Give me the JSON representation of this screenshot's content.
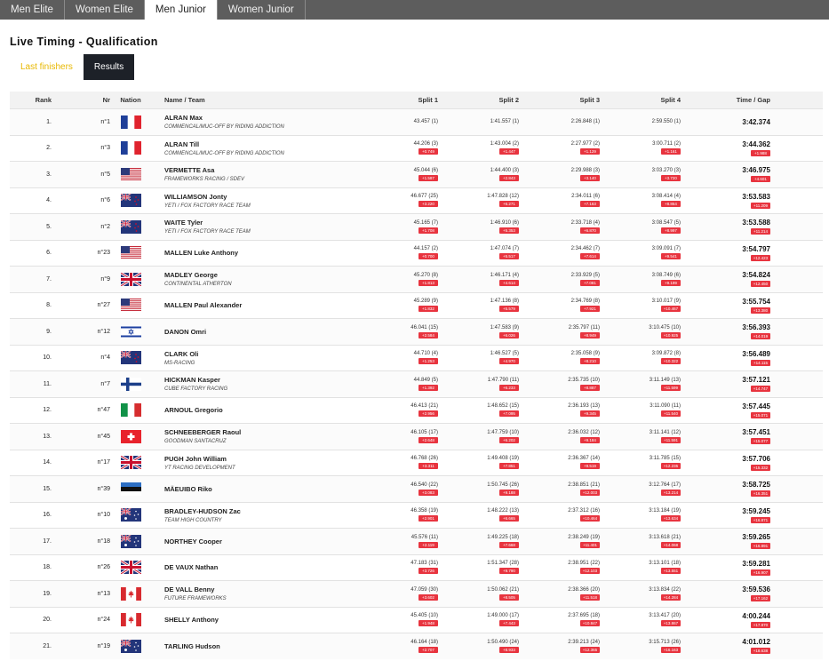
{
  "tabs": [
    {
      "label": "Men Elite",
      "active": false
    },
    {
      "label": "Women Elite",
      "active": false
    },
    {
      "label": "Men Junior",
      "active": true
    },
    {
      "label": "Women Junior",
      "active": false
    }
  ],
  "page_title": "Live Timing - Qualification",
  "subtabs": {
    "last_finishers": "Last finishers",
    "results": "Results"
  },
  "columns": {
    "rank": "Rank",
    "nr": "Nr",
    "nation": "Nation",
    "name": "Name / Team",
    "split1": "Split 1",
    "split2": "Split 2",
    "split3": "Split 3",
    "split4": "Split 4",
    "time": "Time / Gap"
  },
  "colors": {
    "gap_badge": "#e8343f",
    "tabs_bg": "#5d5d5d",
    "results_btn": "#1d2128",
    "last_finishers": "#e8b800"
  },
  "rows": [
    {
      "rank": "1.",
      "nr": "n°1",
      "flag": "fr",
      "name": "ALRAN Max",
      "team": "COMMENCAL/MUC-OFF BY RIDING ADDICTION",
      "s1": "43.457 (1)",
      "g1": "",
      "s2": "1:41.557 (1)",
      "g2": "",
      "s3": "2:26.848 (1)",
      "g3": "",
      "s4": "2:59.550 (1)",
      "g4": "",
      "time": "3:42.374",
      "gap": ""
    },
    {
      "rank": "2.",
      "nr": "n°3",
      "flag": "fr",
      "name": "ALRAN Till",
      "team": "COMMENCAL/MUC-OFF BY RIDING ADDICTION",
      "s1": "44.206 (3)",
      "g1": "+0.749",
      "s2": "1:43.004 (2)",
      "g2": "+1.447",
      "s3": "2:27.977 (2)",
      "g3": "+1.129",
      "s4": "3:00.711 (2)",
      "g4": "+1.161",
      "time": "3:44.362",
      "gap": "+1.988"
    },
    {
      "rank": "3.",
      "nr": "n°5",
      "flag": "us",
      "name": "VERMETTE Asa",
      "team": "FRAMEWORKS RACING / SDEV",
      "s1": "45.044 (6)",
      "g1": "+1.587",
      "s2": "1:44.400 (3)",
      "g2": "+2.843",
      "s3": "2:29.988 (3)",
      "g3": "+3.140",
      "s4": "3:03.270 (3)",
      "g4": "+3.720",
      "time": "3:46.975",
      "gap": "+4.601"
    },
    {
      "rank": "4.",
      "nr": "n°6",
      "flag": "nz",
      "name": "WILLIAMSON Jonty",
      "team": "YETI / FOX FACTORY RACE TEAM",
      "s1": "46.677 (25)",
      "g1": "+3.220",
      "s2": "1:47.828 (12)",
      "g2": "+6.271",
      "s3": "2:34.011 (6)",
      "g3": "+7.163",
      "s4": "3:08.414 (4)",
      "g4": "+8.864",
      "time": "3:53.583",
      "gap": "+11.209"
    },
    {
      "rank": "5.",
      "nr": "n°2",
      "flag": "nz",
      "name": "WAITE Tyler",
      "team": "YETI / FOX FACTORY RACE TEAM",
      "s1": "45.165 (7)",
      "g1": "+1.708",
      "s2": "1:46.910 (6)",
      "g2": "+5.353",
      "s3": "2:33.718 (4)",
      "g3": "+6.870",
      "s4": "3:08.547 (5)",
      "g4": "+8.997",
      "time": "3:53.588",
      "gap": "+11.214"
    },
    {
      "rank": "6.",
      "nr": "n°23",
      "flag": "us",
      "name": "MALLEN Luke Anthony",
      "team": "",
      "s1": "44.157 (2)",
      "g1": "+0.700",
      "s2": "1:47.074 (7)",
      "g2": "+5.517",
      "s3": "2:34.462 (7)",
      "g3": "+7.614",
      "s4": "3:09.091 (7)",
      "g4": "+9.541",
      "time": "3:54.797",
      "gap": "+12.423"
    },
    {
      "rank": "7.",
      "nr": "n°9",
      "flag": "gb",
      "name": "MADLEY George",
      "team": "CONTINENTAL ATHERTON",
      "s1": "45.270 (8)",
      "g1": "+1.813",
      "s2": "1:46.171 (4)",
      "g2": "+4.614",
      "s3": "2:33.929 (5)",
      "g3": "+7.081",
      "s4": "3:08.749 (6)",
      "g4": "+9.199",
      "time": "3:54.824",
      "gap": "+12.450"
    },
    {
      "rank": "8.",
      "nr": "n°27",
      "flag": "us",
      "name": "MALLEN Paul Alexander",
      "team": "",
      "s1": "45.289 (9)",
      "g1": "+1.832",
      "s2": "1:47.136 (8)",
      "g2": "+5.579",
      "s3": "2:34.769 (8)",
      "g3": "+7.921",
      "s4": "3:10.017 (9)",
      "g4": "+10.467",
      "time": "3:55.754",
      "gap": "+13.380"
    },
    {
      "rank": "9.",
      "nr": "n°12",
      "flag": "il",
      "name": "DANON Omri",
      "team": "",
      "s1": "46.041 (15)",
      "g1": "+2.584",
      "s2": "1:47.583 (9)",
      "g2": "+6.026",
      "s3": "2:35.797 (11)",
      "g3": "+8.949",
      "s4": "3:10.475 (10)",
      "g4": "+10.925",
      "time": "3:56.393",
      "gap": "+14.019"
    },
    {
      "rank": "10.",
      "nr": "n°4",
      "flag": "nz",
      "name": "CLARK Oli",
      "team": "MS-RACING",
      "s1": "44.710 (4)",
      "g1": "+1.253",
      "s2": "1:46.527 (5)",
      "g2": "+4.970",
      "s3": "2:35.058 (9)",
      "g3": "+8.210",
      "s4": "3:09.872 (8)",
      "g4": "+10.322",
      "time": "3:56.489",
      "gap": "+14.115"
    },
    {
      "rank": "11.",
      "nr": "n°7",
      "flag": "fi",
      "name": "HICKMAN Kasper",
      "team": "CUBE FACTORY RACING",
      "s1": "44.849 (5)",
      "g1": "+1.392",
      "s2": "1:47.790 (11)",
      "g2": "+6.233",
      "s3": "2:35.735 (10)",
      "g3": "+8.887",
      "s4": "3:11.149 (13)",
      "g4": "+11.599",
      "time": "3:57.121",
      "gap": "+14.747"
    },
    {
      "rank": "12.",
      "nr": "n°47",
      "flag": "it",
      "name": "ARNOUL Gregorio",
      "team": "",
      "s1": "46.413 (21)",
      "g1": "+2.956",
      "s2": "1:48.652 (15)",
      "g2": "+7.095",
      "s3": "2:36.193 (13)",
      "g3": "+9.345",
      "s4": "3:11.090 (11)",
      "g4": "+11.540",
      "time": "3:57.445",
      "gap": "+15.071"
    },
    {
      "rank": "13.",
      "nr": "n°45",
      "flag": "ch",
      "name": "SCHNEEBERGER Raoul",
      "team": "GOODMAN SANTACRUZ",
      "s1": "46.105 (17)",
      "g1": "+2.648",
      "s2": "1:47.759 (10)",
      "g2": "+6.202",
      "s3": "2:36.032 (12)",
      "g3": "+9.184",
      "s4": "3:11.141 (12)",
      "g4": "+11.591",
      "time": "3:57.451",
      "gap": "+15.077"
    },
    {
      "rank": "14.",
      "nr": "n°17",
      "flag": "gb",
      "name": "PUGH John William",
      "team": "YT RACING DEVELOPMENT",
      "s1": "46.768 (26)",
      "g1": "+3.311",
      "s2": "1:49.408 (19)",
      "g2": "+7.851",
      "s3": "2:36.367 (14)",
      "g3": "+9.519",
      "s4": "3:11.785 (15)",
      "g4": "+12.235",
      "time": "3:57.706",
      "gap": "+15.332"
    },
    {
      "rank": "15.",
      "nr": "n°39",
      "flag": "ee",
      "name": "MÄEUIBO Riko",
      "team": "",
      "s1": "46.540 (22)",
      "g1": "+3.083",
      "s2": "1:50.745 (26)",
      "g2": "+9.188",
      "s3": "2:38.851 (21)",
      "g3": "+12.003",
      "s4": "3:12.764 (17)",
      "g4": "+13.214",
      "time": "3:58.725",
      "gap": "+16.351"
    },
    {
      "rank": "16.",
      "nr": "n°10",
      "flag": "au",
      "name": "BRADLEY-HUDSON Zac",
      "team": "TEAM HIGH COUNTRY",
      "s1": "46.358 (19)",
      "g1": "+2.901",
      "s2": "1:48.222 (13)",
      "g2": "+6.665",
      "s3": "2:37.312 (16)",
      "g3": "+10.464",
      "s4": "3:13.184 (19)",
      "g4": "+13.634",
      "time": "3:59.245",
      "gap": "+16.871"
    },
    {
      "rank": "17.",
      "nr": "n°18",
      "flag": "au",
      "name": "NORTHEY Cooper",
      "team": "",
      "s1": "45.576 (11)",
      "g1": "+2.119",
      "s2": "1:49.225 (18)",
      "g2": "+7.668",
      "s3": "2:38.249 (19)",
      "g3": "+11.401",
      "s4": "3:13.618 (21)",
      "g4": "+14.068",
      "time": "3:59.265",
      "gap": "+16.891"
    },
    {
      "rank": "18.",
      "nr": "n°26",
      "flag": "gb",
      "name": "DE VAUX Nathan",
      "team": "",
      "s1": "47.183 (31)",
      "g1": "+3.726",
      "s2": "1:51.347 (28)",
      "g2": "+9.790",
      "s3": "2:38.951 (22)",
      "g3": "+12.103",
      "s4": "3:13.101 (18)",
      "g4": "+13.551",
      "time": "3:59.281",
      "gap": "+16.907"
    },
    {
      "rank": "19.",
      "nr": "n°13",
      "flag": "ca",
      "name": "DE VALL Benny",
      "team": "FUTURE FRAMEWORKS",
      "s1": "47.059 (30)",
      "g1": "+3.602",
      "s2": "1:50.062 (21)",
      "g2": "+8.505",
      "s3": "2:38.366 (20)",
      "g3": "+11.518",
      "s4": "3:13.834 (22)",
      "g4": "+14.284",
      "time": "3:59.536",
      "gap": "+17.162"
    },
    {
      "rank": "20.",
      "nr": "n°24",
      "flag": "ca",
      "name": "SHELLY Anthony",
      "team": "",
      "s1": "45.405 (10)",
      "g1": "+1.948",
      "s2": "1:49.000 (17)",
      "g2": "+7.443",
      "s3": "2:37.695 (18)",
      "g3": "+10.847",
      "s4": "3:13.417 (20)",
      "g4": "+13.867",
      "time": "4:00.244",
      "gap": "+17.870"
    },
    {
      "rank": "21.",
      "nr": "n°19",
      "flag": "au",
      "name": "TARLING Hudson",
      "team": "",
      "s1": "46.164 (18)",
      "g1": "+2.707",
      "s2": "1:50.490 (24)",
      "g2": "+8.933",
      "s3": "2:39.213 (24)",
      "g3": "+12.365",
      "s4": "3:15.713 (26)",
      "g4": "+16.163",
      "time": "4:01.012",
      "gap": "+18.638"
    }
  ]
}
